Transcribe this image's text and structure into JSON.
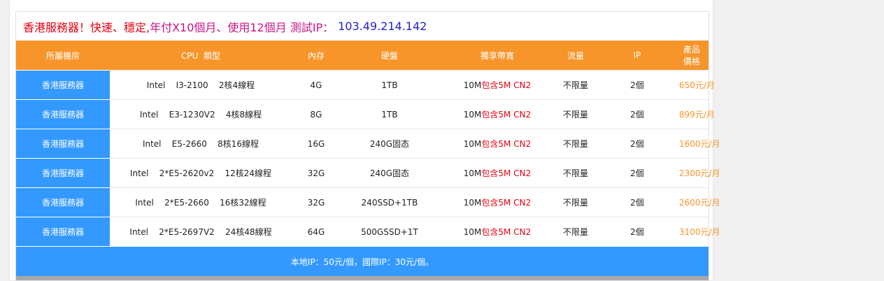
{
  "title": {
    "part1": "香港服務器！快速、穩定,",
    "part2": "年付X10個月、使用12個月 測試IP：",
    "ip": "103.49.214.142"
  },
  "table": {
    "headers": [
      "所屬機房",
      "CPU  類型",
      "內存",
      "硬盤",
      "獨享帶寬",
      "流量",
      "IP",
      "產品價格"
    ],
    "rows": [
      {
        "room": "香港服務器",
        "cpu": "Intel    I3-2100    2核4線程",
        "ram": "4G",
        "disk": "1TB",
        "bw_main": "10M",
        "bw_extra": "包含5M CN2",
        "traffic": "不限量",
        "ip": "2個",
        "price": "650元/月"
      },
      {
        "room": "香港服務器",
        "cpu": "Intel    E3-1230V2    4核8線程",
        "ram": "8G",
        "disk": "1TB",
        "bw_main": "10M",
        "bw_extra": "包含5M CN2",
        "traffic": "不限量",
        "ip": "2個",
        "price": "899元/月"
      },
      {
        "room": "香港服務器",
        "cpu": "Intel    E5-2660    8核16線程",
        "ram": "16G",
        "disk": "240G固态",
        "bw_main": "10M",
        "bw_extra": "包含5M CN2",
        "traffic": "不限量",
        "ip": "2個",
        "price": "1600元/月"
      },
      {
        "room": "香港服務器",
        "cpu": "Intel    2*E5-2620v2    12核24線程",
        "ram": "32G",
        "disk": "240G固态",
        "bw_main": "10M",
        "bw_extra": "包含5M CN2",
        "traffic": "不限量",
        "ip": "2個",
        "price": "2300元/月"
      },
      {
        "room": "香港服務器",
        "cpu": "Intel    2*E5-2660    16核32線程",
        "ram": "32G",
        "disk": "240SSD+1TB",
        "bw_main": "10M",
        "bw_extra": "包含5M CN2",
        "traffic": "不限量",
        "ip": "2個",
        "price": "2600元/月"
      },
      {
        "room": "香港服務器",
        "cpu": "Intel    2*E5-2697V2    24核48線程",
        "ram": "64G",
        "disk": "500GSSD+1T",
        "bw_main": "10M",
        "bw_extra": "包含5M CN2",
        "traffic": "不限量",
        "ip": "2個",
        "price": "3100元/月"
      }
    ]
  },
  "footer": {
    "note": "本地IP：50元/個，國際IP：30元/個。"
  },
  "colors": {
    "header_bg": "#f7952a",
    "room_bg": "#3399ff",
    "price": "#f7952a",
    "highlight_red": "#e60012",
    "title_magenta": "#c71585",
    "title_blue": "#1f1fd0"
  }
}
